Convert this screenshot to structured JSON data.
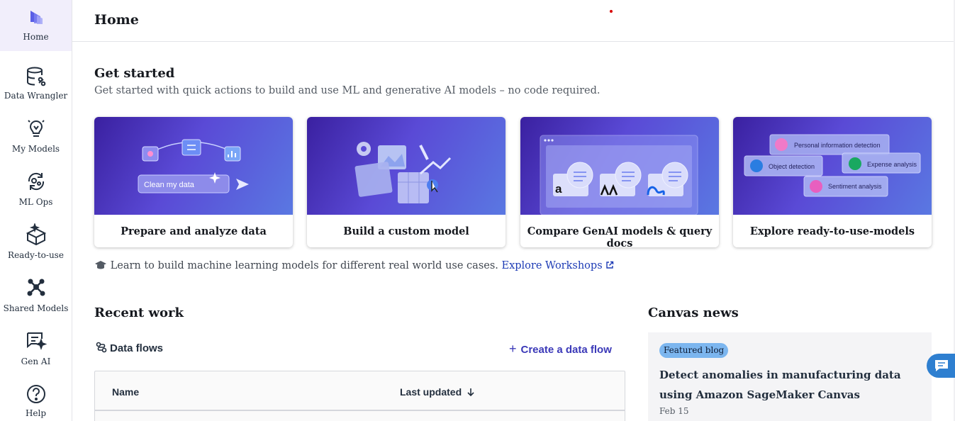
{
  "sidebar": {
    "items": [
      {
        "label": "Home",
        "icon": "home-logo-icon"
      },
      {
        "label": "Data Wrangler",
        "icon": "database-icon"
      },
      {
        "label": "My Models",
        "icon": "lightbulb-icon"
      },
      {
        "label": "ML Ops",
        "icon": "ml-ops-icon"
      },
      {
        "label": "Ready-to-use",
        "icon": "box-sparkle-icon"
      },
      {
        "label": "Shared Models",
        "icon": "network-icon"
      },
      {
        "label": "Gen AI",
        "icon": "chat-sparkle-icon"
      },
      {
        "label": "Help",
        "icon": "help-icon"
      }
    ]
  },
  "header": {
    "title": "Home"
  },
  "get_started": {
    "title": "Get started",
    "subtitle": "Get started with quick actions to build and use ML and generative AI models – no code required.",
    "cards": [
      {
        "label": "Prepare and analyze data",
        "illustration_text": "Clean my data"
      },
      {
        "label": "Build a custom model"
      },
      {
        "label": "Compare GenAI models & query docs",
        "illustration_text": "a"
      },
      {
        "label": "Explore ready-to-use-models",
        "chips": [
          "Personal information detection",
          "Object detection",
          "Expense analysis",
          "Sentiment analysis"
        ]
      }
    ],
    "workshop_text": "Learn to build machine learning models for different real world use cases.",
    "workshop_link": "Explore Workshops"
  },
  "recent_work": {
    "title": "Recent work",
    "data_flows_label": "Data flows",
    "create_label": "Create a data flow",
    "table": {
      "columns": [
        "Name",
        "Last updated"
      ]
    }
  },
  "news": {
    "title": "Canvas news",
    "badge": "Featured blog",
    "headline": "Detect anomalies in manufacturing data using Amazon SageMaker Canvas",
    "date": "Feb 15"
  },
  "colors": {
    "accent": "#3b39b8",
    "link": "#1d3bb5",
    "active_nav": "#f1eefb",
    "chat": "#2e7fd0"
  }
}
